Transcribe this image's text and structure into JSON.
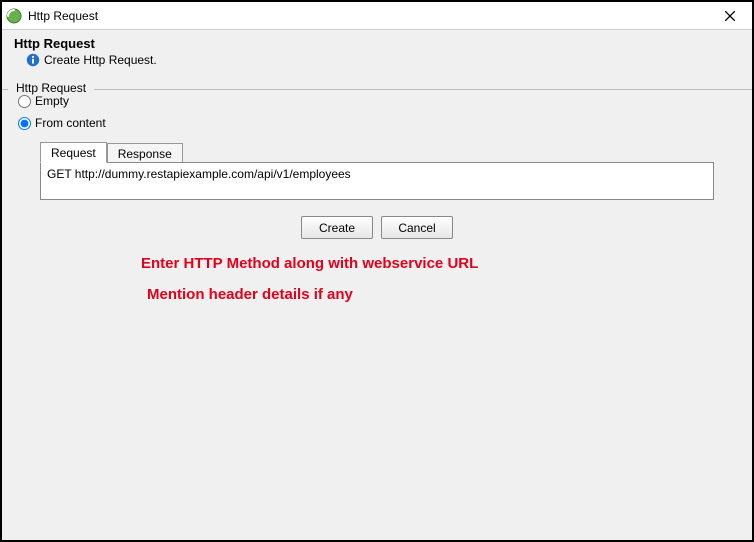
{
  "window": {
    "title": "Http Request"
  },
  "header": {
    "title": "Http Request",
    "subtitle": "Create Http Request."
  },
  "group": {
    "label": "Http Request",
    "radio_empty": "Empty",
    "radio_from_content": "From content",
    "selected": "from_content"
  },
  "tabs": {
    "request": "Request",
    "response": "Response",
    "active": "request"
  },
  "textarea": {
    "value": "GET http://dummy.restapiexample.com/api/v1/employees"
  },
  "annotations": {
    "line1": "Enter HTTP Method along with webservice URL",
    "line2": "Mention header details if any"
  },
  "buttons": {
    "create": "Create",
    "cancel": "Cancel"
  }
}
